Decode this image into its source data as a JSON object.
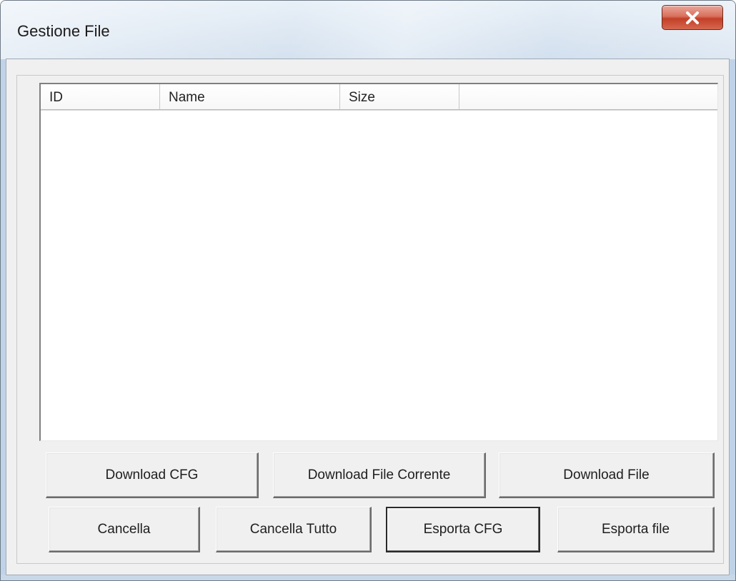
{
  "window": {
    "title": "Gestione File"
  },
  "titlebar": {
    "close_icon": "close-x-icon"
  },
  "list": {
    "columns": [
      "ID",
      "Name",
      "Size",
      ""
    ],
    "rows": []
  },
  "buttons": {
    "download_cfg": "Download CFG",
    "download_file_corrente": "Download File Corrente",
    "download_file": "Download File",
    "cancella": "Cancella",
    "cancella_tutto": "Cancella Tutto",
    "esporta_cfg": "Esporta CFG",
    "esporta_file": "Esporta file"
  },
  "colors": {
    "close_button": "#c94a33",
    "client_background": "#f0f0f0",
    "list_background": "#ffffff"
  }
}
